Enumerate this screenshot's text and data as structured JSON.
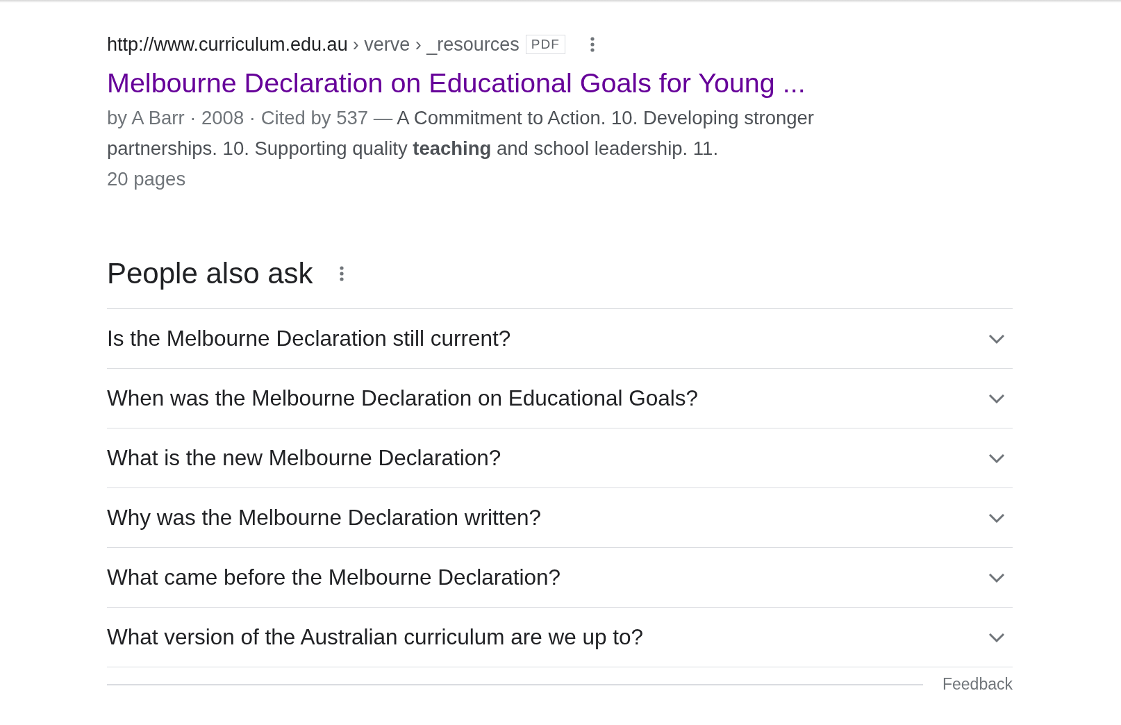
{
  "result": {
    "breadcrumb": "http://www.curriculum.edu.au",
    "path": "› verve › _resources",
    "file_type": "PDF",
    "title": "Melbourne Declaration on Educational Goals for Young ...",
    "meta": "by A Barr · 2008 · Cited by 537 —",
    "snippet": "A Commitment to Action. 10. Developing stronger partnerships. 10. Supporting quality **teaching** and school leadership. 11.",
    "pages": "20 pages"
  },
  "people_also_ask": {
    "heading": "People also ask",
    "questions": [
      {
        "text": "Is the Melbourne Declaration still current?",
        "expanded": false
      },
      {
        "text": "When was the Melbourne Declaration on Educational Goals?",
        "expanded": false
      },
      {
        "text": "What is the new Melbourne Declaration?",
        "expanded": false
      },
      {
        "text": "Why was the Melbourne Declaration written?",
        "expanded": false
      },
      {
        "text": "What came before the Melbourne Declaration?",
        "expanded": false
      },
      {
        "text": "What version of the Australian curriculum are we up to?",
        "expanded": false
      }
    ],
    "feedback": "Feedback"
  }
}
